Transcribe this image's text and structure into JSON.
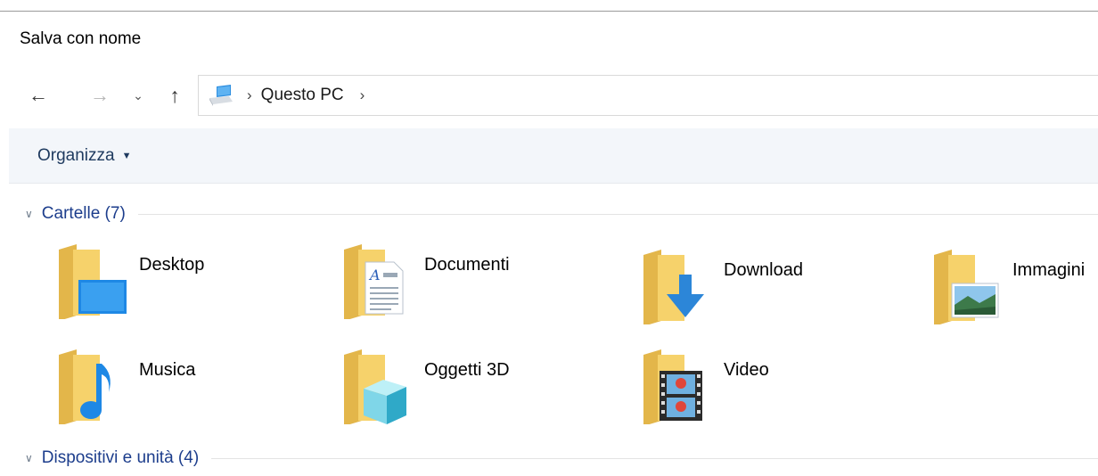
{
  "window": {
    "title": "Salva con nome"
  },
  "nav": {
    "back_icon": "arrow-left-icon",
    "forward_icon": "arrow-right-icon",
    "recent_icon": "chevron-down-icon",
    "up_icon": "arrow-up-icon"
  },
  "address": {
    "location_icon": "computer-icon",
    "crumbs": [
      "Questo PC"
    ]
  },
  "toolbar": {
    "organize_label": "Organizza"
  },
  "groups": {
    "folders": {
      "label": "Cartelle (7)",
      "items": [
        {
          "label": "Desktop",
          "icon": "desktop-folder-icon"
        },
        {
          "label": "Documenti",
          "icon": "documents-folder-icon"
        },
        {
          "label": "Download",
          "icon": "downloads-folder-icon"
        },
        {
          "label": "Immagini",
          "icon": "pictures-folder-icon"
        },
        {
          "label": "Musica",
          "icon": "music-folder-icon"
        },
        {
          "label": "Oggetti 3D",
          "icon": "3d-objects-folder-icon"
        },
        {
          "label": "Video",
          "icon": "videos-folder-icon"
        }
      ]
    },
    "devices": {
      "label": "Dispositivi e unità (4)"
    }
  },
  "colors": {
    "folder_yellow": "#f6d26b",
    "folder_yellow_dark": "#e3b64a",
    "group_header": "#1c3d8c",
    "toolbar_bg": "#f3f6fa",
    "accent_blue": "#1e88e5"
  }
}
